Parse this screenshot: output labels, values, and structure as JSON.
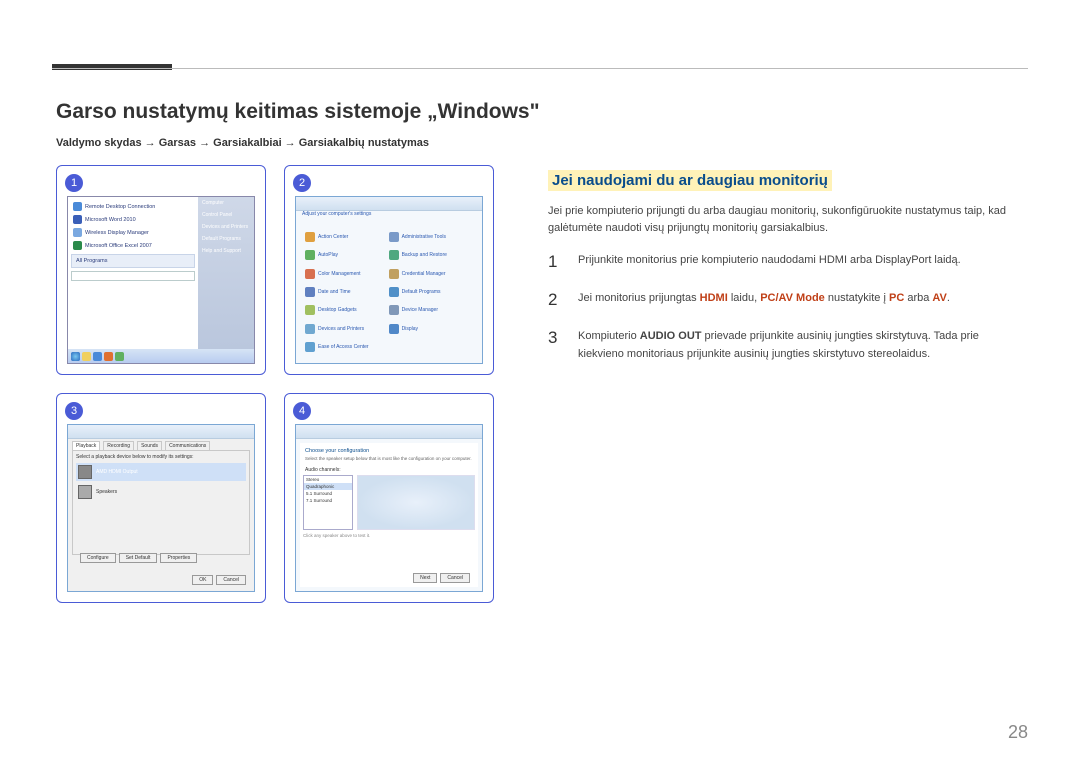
{
  "title": "Garso nustatymų keitimas sistemoje „Windows\"",
  "breadcrumb": "Valdymo skydas → Garsas → Garsiakalbiai → Garsiakalbių nustatymas",
  "panels": {
    "b1": "1",
    "b2": "2",
    "b3": "3",
    "b4": "4",
    "p1": {
      "items": [
        "Remote Desktop Connection",
        "Microsoft Word 2010",
        "Wireless Display Manager",
        "Microsoft Office Excel 2007"
      ],
      "all": "All Programs",
      "right": [
        "Computer",
        "Control Panel",
        "Devices and Printers",
        "Default Programs",
        "Help and Support"
      ]
    },
    "p2": {
      "head": "Adjust your computer's settings",
      "items": [
        "Action Center",
        "Administrative Tools",
        "AutoPlay",
        "Backup and Restore",
        "Color Management",
        "Credential Manager",
        "Date and Time",
        "Default Programs",
        "Desktop Gadgets",
        "Device Manager",
        "Devices and Printers",
        "Display",
        "Ease of Access Center"
      ]
    },
    "p3": {
      "tabs": [
        "Playback",
        "Recording",
        "Sounds",
        "Communications"
      ],
      "prompt": "Select a playback device below to modify its settings:",
      "dev1": "AMD HDMI Output",
      "dev2": "Speakers",
      "btns": [
        "Configure",
        "Set Default",
        "Properties"
      ],
      "okc": [
        "OK",
        "Cancel"
      ]
    },
    "p4": {
      "title": "Choose your configuration",
      "sub": "Select the speaker setup below that is most like the configuration on your computer.",
      "lab": "Audio channels:",
      "opts": [
        "Stereo",
        "Quadraphonic",
        "5.1 Surround",
        "7.1 Surround"
      ],
      "note": "Click any speaker above to test it.",
      "btns": [
        "Next",
        "Cancel"
      ]
    }
  },
  "right": {
    "heading": "Jei naudojami du ar daugiau monitorių",
    "intro": "Jei prie kompiuterio prijungti du arba daugiau monitorių, sukonfigūruokite nustatymus taip, kad galėtumėte naudoti visų prijungtų monitorių garsiakalbius.",
    "s1": {
      "n": "1",
      "t": "Prijunkite monitorius prie kompiuterio naudodami HDMI arba DisplayPort laidą."
    },
    "s2": {
      "n": "2",
      "pre": "Jei monitorius prijungtas ",
      "hdmi": "HDMI",
      "mid": " laidu, ",
      "mode": "PC/AV Mode",
      "mid2": " nustatykite į ",
      "pc": "PC",
      "or": " arba ",
      "av": "AV",
      "end": "."
    },
    "s3": {
      "n": "3",
      "pre": "Kompiuterio ",
      "ao": "AUDIO OUT",
      "rest": " prievade prijunkite ausinių jungties skirstytuvą. Tada prie kiekvieno monitoriaus prijunkite ausinių jungties skirstytuvo stereolaidus."
    }
  },
  "page": "28"
}
